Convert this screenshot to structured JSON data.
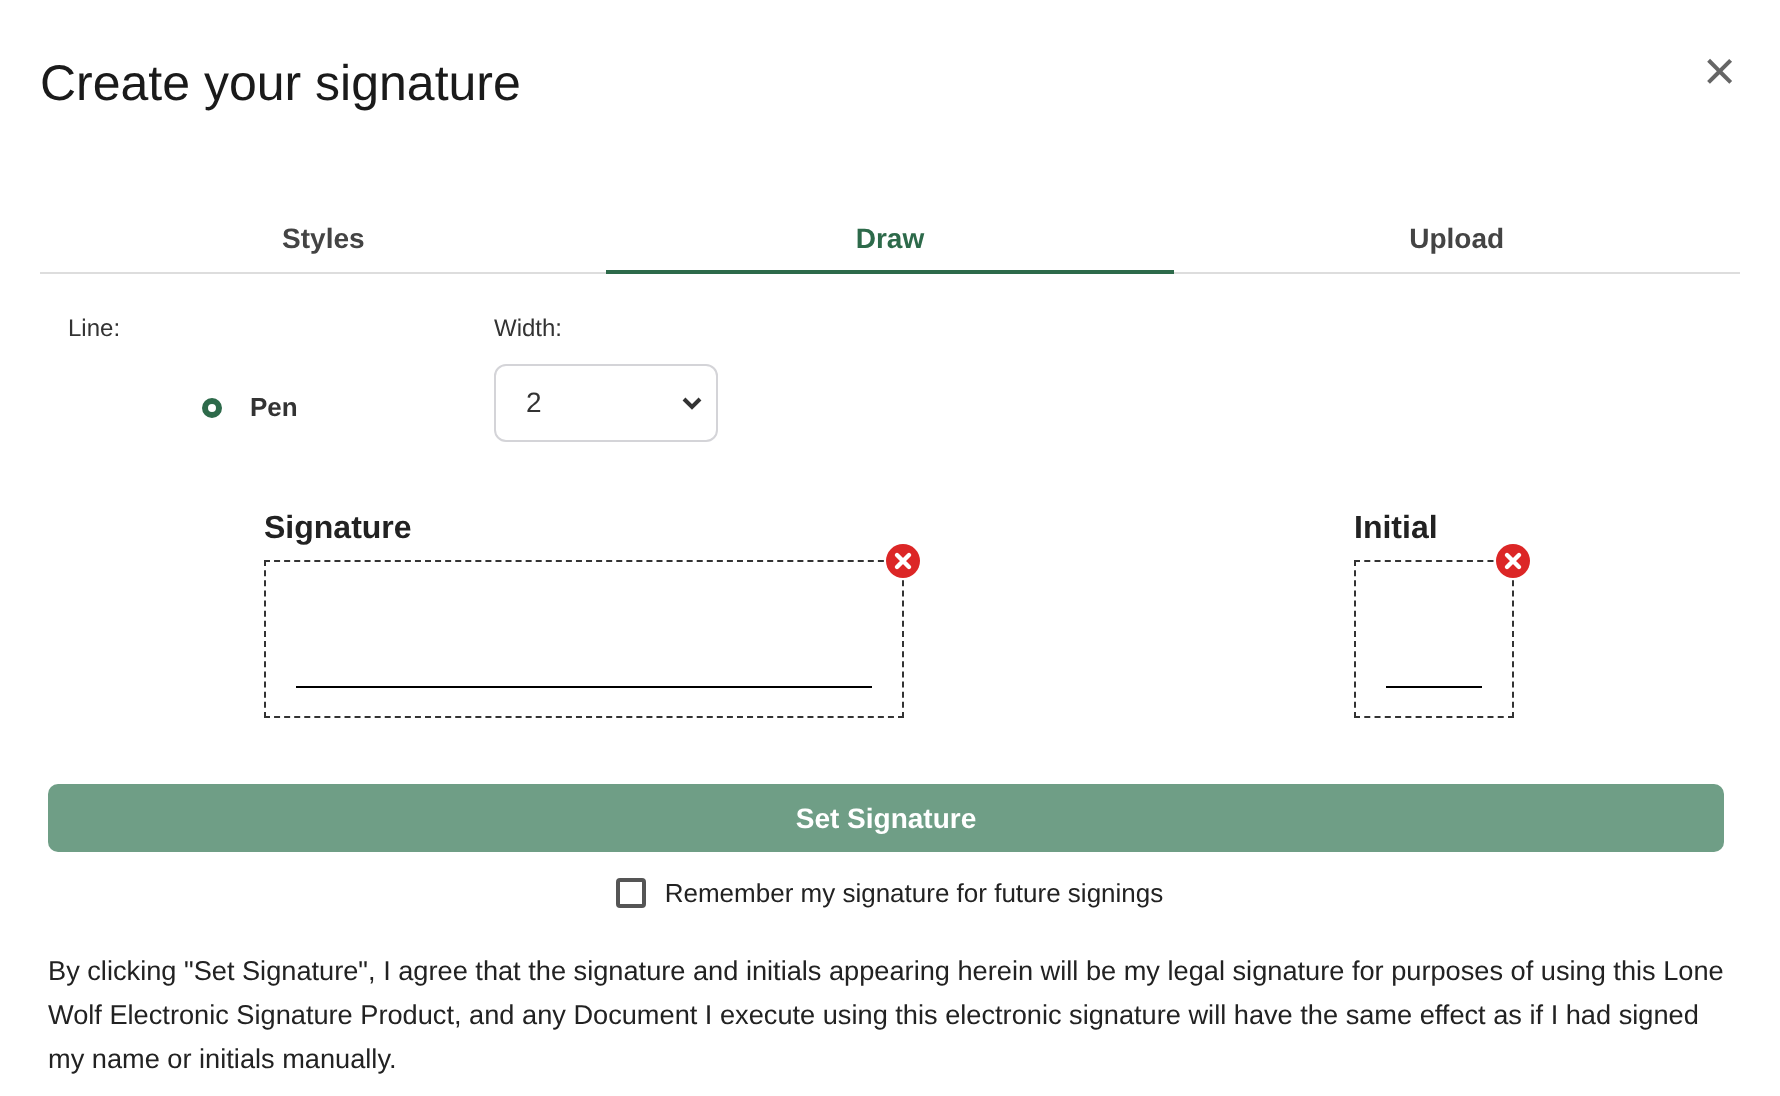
{
  "dialog": {
    "title": "Create your signature",
    "close": "×"
  },
  "tabs": [
    {
      "label": "Styles",
      "selected": false
    },
    {
      "label": "Draw",
      "selected": true
    },
    {
      "label": "Upload",
      "selected": false
    }
  ],
  "line": {
    "label": "Line:",
    "options": [
      {
        "label": "Pen",
        "selected": true
      }
    ]
  },
  "width": {
    "label": "Width:",
    "value": "2"
  },
  "pads": [
    {
      "label": "Signature",
      "kind": "wide"
    },
    {
      "label": "Initial",
      "kind": "narrow"
    }
  ],
  "set_button": {
    "label": "Set Signature"
  },
  "remember": {
    "label": "Remember my signature for future signings",
    "checked": false
  },
  "disclaimer": "By clicking \"Set Signature\", I agree that the signature and initials appearing herein will be my legal signature for purposes of using this Lone Wolf Electronic Signature Product, and any Document I execute using this electronic signature will have the same effect as if I had signed my name or initials manually."
}
